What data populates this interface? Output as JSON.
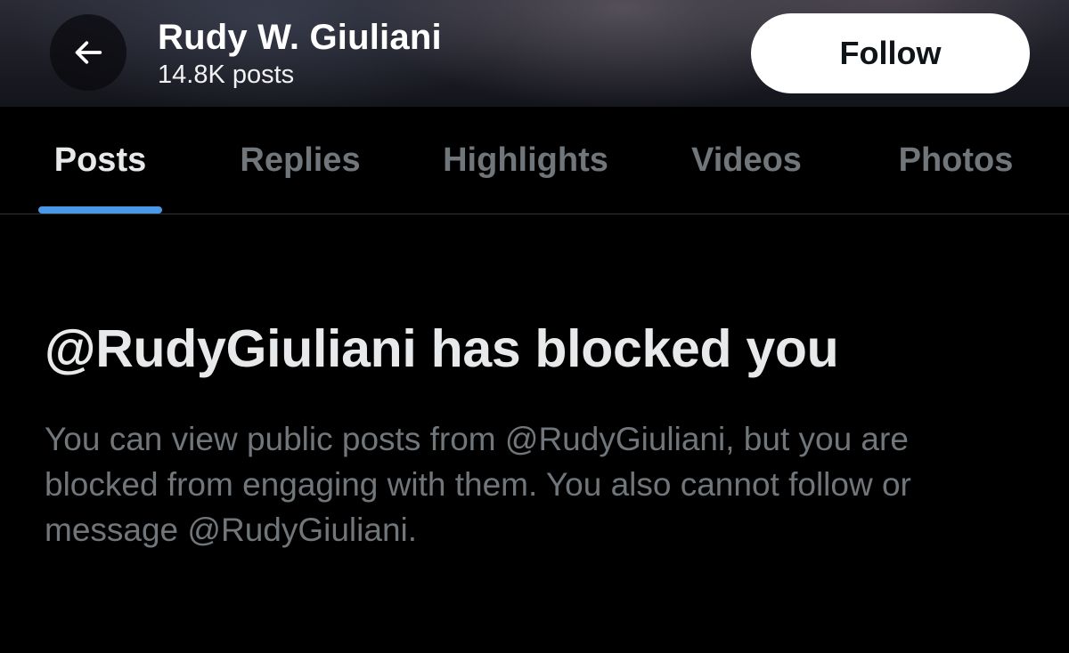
{
  "header": {
    "back_icon": "arrow-left-icon",
    "profile_name": "Rudy W. Giuliani",
    "post_count": "14.8K posts",
    "follow_label": "Follow"
  },
  "tabs": [
    {
      "label": "Posts",
      "active": true
    },
    {
      "label": "Replies",
      "active": false
    },
    {
      "label": "Highlights",
      "active": false
    },
    {
      "label": "Videos",
      "active": false
    },
    {
      "label": "Photos",
      "active": false
    }
  ],
  "blocked_notice": {
    "title": "@RudyGiuliani has blocked you",
    "message": "You can view public posts from @RudyGiuliani, but you are blocked from engaging with them. You also cannot follow or message @RudyGiuliani."
  },
  "colors": {
    "background": "#000000",
    "primary_text": "#e7e9ea",
    "secondary_text": "#71767b",
    "accent": "#4a99e9",
    "follow_button_bg": "#ffffff"
  }
}
